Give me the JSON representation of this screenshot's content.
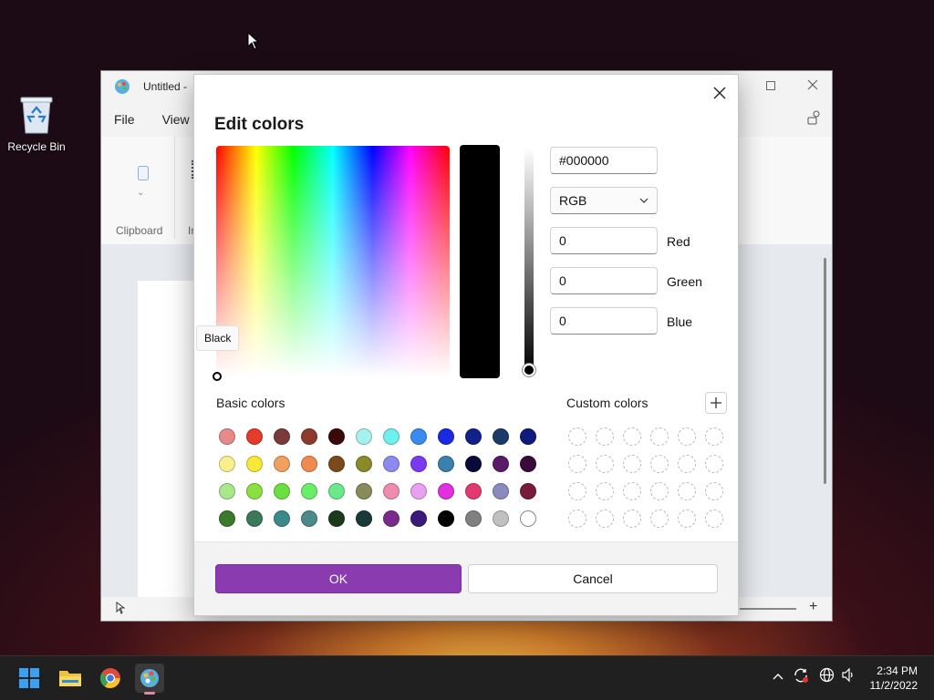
{
  "desktop": {
    "recycle_bin_label": "Recycle Bin"
  },
  "paint": {
    "title": "Untitled -",
    "menu": [
      "File",
      "View"
    ],
    "ribbon": {
      "clipboard_label": "Clipboard",
      "image_label_fragment": "In"
    }
  },
  "dialog": {
    "title": "Edit colors",
    "tooltip": "Black",
    "hex_value": "#000000",
    "mode": "RGB",
    "fields": [
      {
        "label": "Red",
        "value": "0"
      },
      {
        "label": "Green",
        "value": "0"
      },
      {
        "label": "Blue",
        "value": "0"
      }
    ],
    "basic_colors_label": "Basic colors",
    "custom_colors_label": "Custom colors",
    "basic_colors": [
      "#e78a8a",
      "#e53b2d",
      "#7a3a3a",
      "#8c3a2e",
      "#3a0a0a",
      "#a8f0f0",
      "#6ef0f0",
      "#3a8af0",
      "#1a2ae0",
      "#12208a",
      "#1a3a6a",
      "#101a7a",
      "#f8f08a",
      "#f8e83a",
      "#f0a060",
      "#f08a50",
      "#7a4a1a",
      "#8a8a2a",
      "#8a8af0",
      "#7a3af0",
      "#3a80b0",
      "#0a0a3a",
      "#5a1a6a",
      "#3a0a3a",
      "#a8e88a",
      "#8ae040",
      "#6ae040",
      "#6aee6a",
      "#6ae88a",
      "#8a8a5a",
      "#f08ab0",
      "#e8a0f0",
      "#e030e0",
      "#e03a70",
      "#8a8ac0",
      "#7a1a3a",
      "#3a7a2a",
      "#3a7a5a",
      "#3a8a8a",
      "#4a8a8a",
      "#1a3a1a",
      "#1a3a3a",
      "#7a2a8a",
      "#3a1a7a",
      "#000000",
      "#808080",
      "#c0c0c0",
      "#ffffff"
    ],
    "ok_label": "OK",
    "cancel_label": "Cancel"
  },
  "taskbar": {
    "apps": [
      "start-icon",
      "file-explorer-icon",
      "chrome-icon",
      "paint-icon"
    ],
    "time": "2:34 PM",
    "date": "11/2/2022"
  }
}
